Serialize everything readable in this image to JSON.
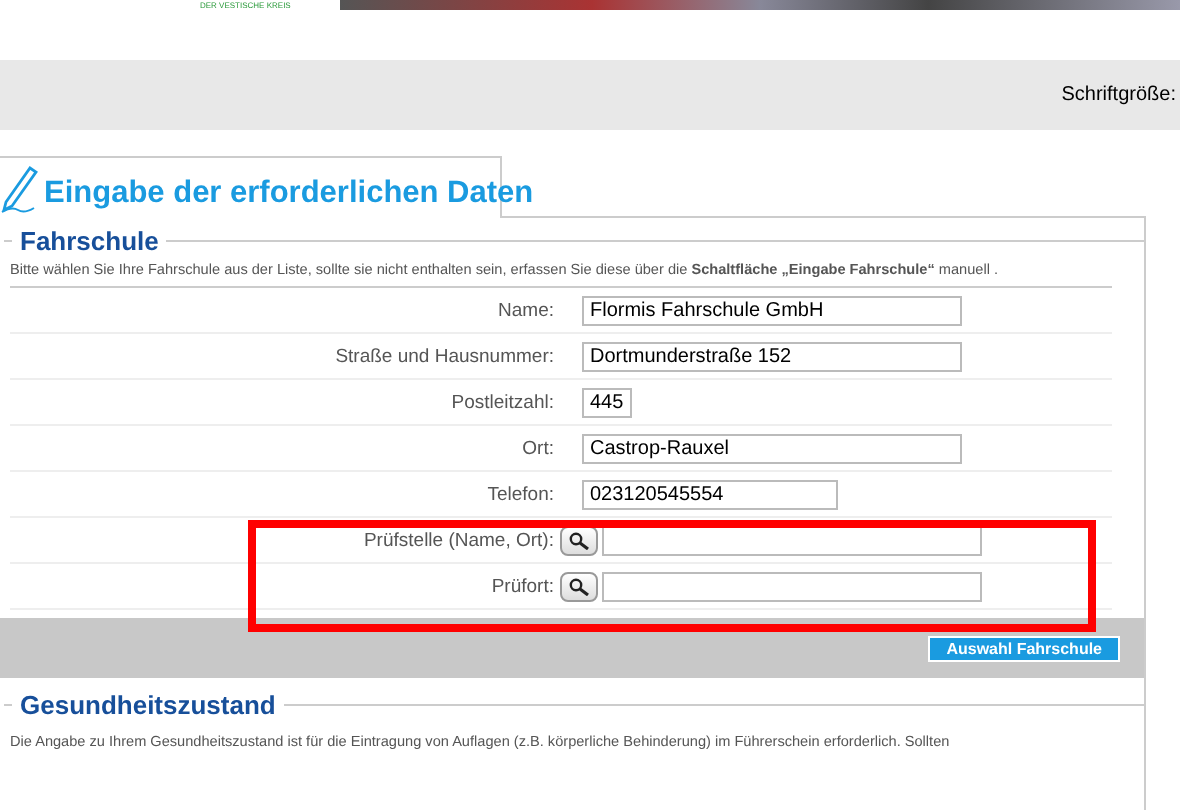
{
  "header": {
    "logo_text": "DER VESTISCHE KREIS"
  },
  "toolbar": {
    "font_size_label": "Schriftgröße:"
  },
  "tab": {
    "title": "Eingabe der erforderlichen Daten"
  },
  "fahrschule": {
    "legend": "Fahrschule",
    "hint": "Bitte wählen Sie Ihre Fahrschule aus der Liste, sollte sie nicht enthalten sein, erfassen Sie diese über die **Schaltfläche „Eingabe Fahrschule“** manuell .",
    "rows": [
      {
        "kind": "text",
        "label": "Name:",
        "value": "Flormis Fahrschule GmbH"
      },
      {
        "kind": "text",
        "label": "Straße und Hausnummer:",
        "value": "Dortmunderstraße 152"
      },
      {
        "kind": "text",
        "label": "Postleitzahl:",
        "value": "445"
      },
      {
        "kind": "text",
        "label": "Ort:",
        "value": "Castrop-Rauxel"
      },
      {
        "kind": "text",
        "label": "Telefon:",
        "value": "023120545554"
      },
      {
        "kind": "lookup",
        "label": "Prüfstelle (Name, Ort):",
        "value": "",
        "highlighted": true
      },
      {
        "kind": "lookup",
        "label": "Prüfort:",
        "value": "",
        "highlighted": true
      }
    ],
    "button": "Auswahl Fahrschule"
  },
  "gesundheit": {
    "legend": "Gesundheitszustand",
    "hint": "Die Angabe zu Ihrem Gesundheitszustand ist für die Eintragung von Auflagen (z.B. körperliche Behinderung) im Führerschein erforderlich. Sollten"
  }
}
